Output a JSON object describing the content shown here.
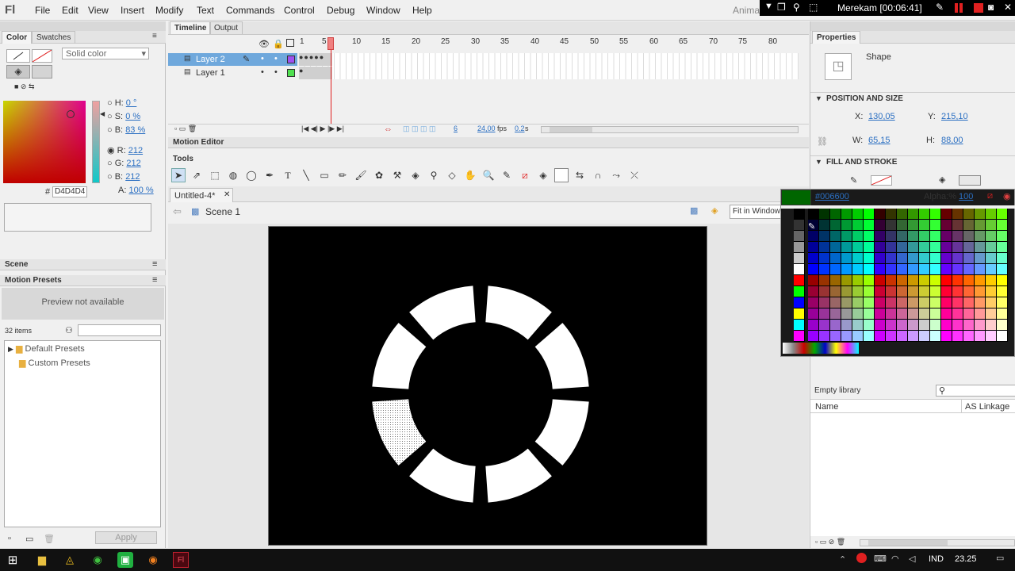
{
  "app": {
    "logo": "Fl",
    "menu": [
      "File",
      "Edit",
      "View",
      "Insert",
      "Modify",
      "Text",
      "Commands",
      "Control",
      "Debug",
      "Window",
      "Help"
    ],
    "workspace": "Anima",
    "recording": "Merekam [00:06:41]"
  },
  "color_panel": {
    "tabs": [
      "Color",
      "Swatches"
    ],
    "fill_type": "Solid color",
    "h_label": "H:",
    "h": "0 °",
    "s_label": "S:",
    "s": "0 %",
    "b_label": "B:",
    "b": "83 %",
    "r_label": "R:",
    "r": "212",
    "g_label": "G:",
    "g": "212",
    "bl_label": "B:",
    "bl": "212",
    "hex_prefix": "#",
    "hex": "D4D4D4",
    "alpha_label": "A:",
    "alpha": "100 %"
  },
  "scene_panel": {
    "title": "Scene"
  },
  "motion_presets": {
    "title": "Motion Presets",
    "preview": "Preview not available",
    "count": "32 items",
    "folders": [
      "Default Presets",
      "Custom Presets"
    ],
    "apply": "Apply"
  },
  "timeline": {
    "tabs": [
      "Timeline",
      "Output"
    ],
    "ticks": [
      "1",
      "5",
      "10",
      "15",
      "20",
      "25",
      "30",
      "35",
      "40",
      "45",
      "50",
      "55",
      "60",
      "65",
      "70",
      "75",
      "80"
    ],
    "layers": [
      "Layer 2",
      "Layer 1"
    ],
    "frame": "6",
    "fps": "24,00",
    "fps_unit": "fps",
    "time": "0.2",
    "time_unit": "s"
  },
  "motion_editor": {
    "title": "Motion Editor"
  },
  "tools": {
    "title": "Tools"
  },
  "document": {
    "tab": "Untitled-4*",
    "scene": "Scene 1",
    "zoom": "Fit in Window"
  },
  "properties": {
    "title": "Properties",
    "type": "Shape",
    "pos_title": "POSITION AND SIZE",
    "x_label": "X:",
    "x": "130,05",
    "y_label": "Y:",
    "y": "215,10",
    "w_label": "W:",
    "w": "65,15",
    "h_label": "H:",
    "h": "88,00",
    "fill_title": "FILL AND STROKE",
    "swatch_hex": "#006600",
    "alpha_label": "Alpha:%",
    "alpha": "100"
  },
  "library": {
    "empty": "Empty library",
    "col_name": "Name",
    "col_linkage": "AS Linkage"
  },
  "taskbar": {
    "lang": "IND",
    "clock": "23.25"
  },
  "colors": {
    "stage": "#000000",
    "ring": "#ffffff",
    "selected_segment": "#d4d4d4",
    "swatch_selected": "#006600",
    "layer_selected": "#6fa8dc"
  }
}
